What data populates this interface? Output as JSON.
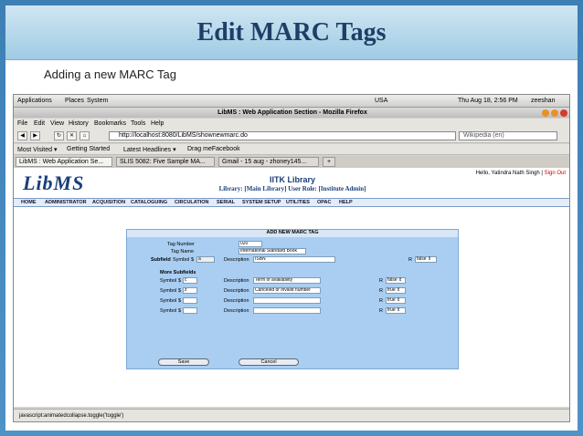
{
  "slide": {
    "title": "Edit MARC Tags",
    "subtitle": "Adding a new MARC Tag"
  },
  "desktop": {
    "menu_applications": "Applications",
    "menu_places": "Places",
    "menu_system": "System",
    "keyboard": "USA",
    "clock": "Thu Aug 18,  2:56 PM",
    "user": "zeeshan"
  },
  "browser": {
    "window_title": "LibMS : Web Application Section - Mozilla Firefox",
    "menu": [
      "File",
      "Edit",
      "View",
      "History",
      "Bookmarks",
      "Tools",
      "Help"
    ],
    "url": "http://localhost:8080/LibMS/shownewmarc.do",
    "search_placeholder": "Wikipedia (en)",
    "bookmarks": [
      "Most Visited ▾",
      "Getting Started",
      "Latest Headlines ▾",
      "Drag meFacebook"
    ],
    "tabs": [
      "LibMS : Web Application Se...",
      "SLIS 5082: Five Sample MA...",
      "Gmail - 15 aug - zhoney145..."
    ],
    "status": "javascript:animatedcollapse.toggle('toggle')"
  },
  "app": {
    "logo": "LibMS",
    "hello": "Hello,  Yatindra Nath Singh",
    "signout": "Sign Out",
    "library_name": "IITK Library",
    "role_line": "Library: [Main Library]  User Role: [Institute Admin]",
    "nav": [
      "HOME",
      "ADMINISTRATOR",
      "ACQUISITION",
      "CATALOGUING",
      "CIRCULATION",
      "SERIAL",
      "SYSTEM SETUP",
      "UTILITIES",
      "OPAC",
      "HELP"
    ]
  },
  "form": {
    "heading": "ADD NEW MARC TAG",
    "tag_number_label": "Tag Number",
    "tag_number_value": "020",
    "tag_name_label": "Tag Name",
    "tag_name_value": "International Standard Book",
    "subfield_symbol_label": "Subfield",
    "symbol_label": "Symbol",
    "dollar": "$",
    "subfield_symbol_value": "a",
    "description_label": "Description",
    "description_value": "ISBN",
    "r_label": "R",
    "r_value": "false",
    "more_subfields_label": "More Subfields",
    "rows": [
      {
        "symbol": "c",
        "description": "Term of availability",
        "r": "false"
      },
      {
        "symbol": "z",
        "description": "Canceled or invalid number",
        "r": "true"
      },
      {
        "symbol": "",
        "description": "",
        "r": "true"
      },
      {
        "symbol": "",
        "description": "",
        "r": "true"
      }
    ],
    "save_label": "Save",
    "cancel_label": "Cancel"
  }
}
